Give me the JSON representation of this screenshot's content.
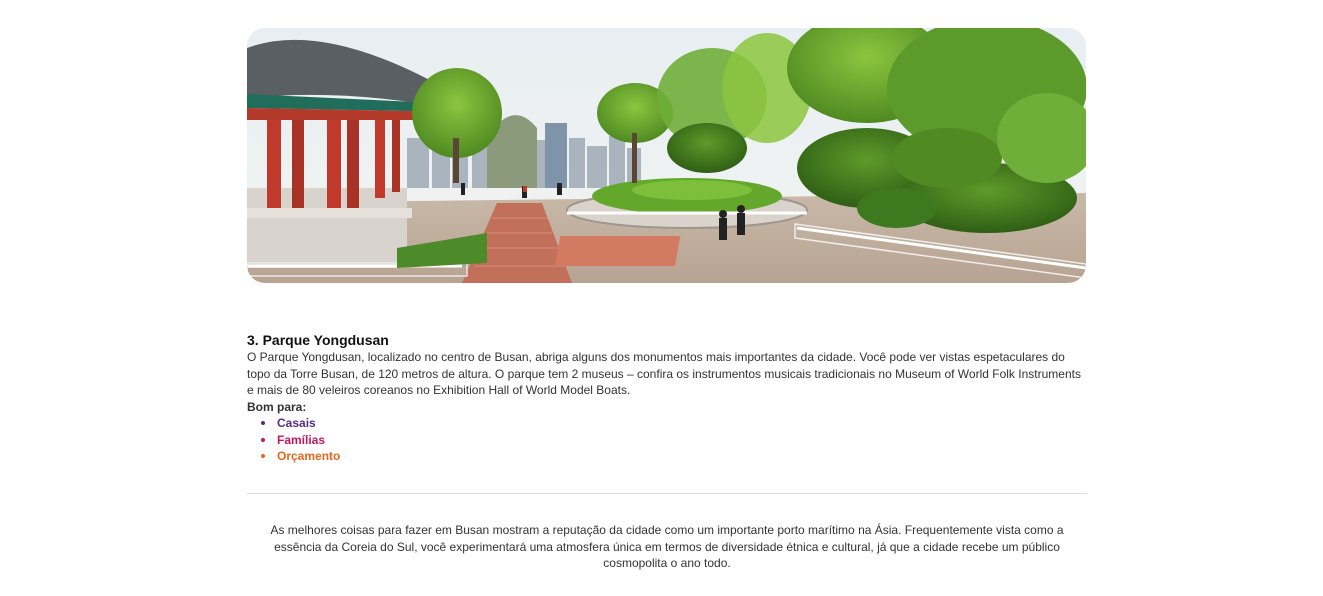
{
  "attraction": {
    "image_alt": "Parque Yongdusan",
    "title": "3. Parque Yongdusan",
    "description": "O Parque Yongdusan, localizado no centro de Busan, abriga alguns dos monumentos mais importantes da cidade. Você pode ver vistas espetaculares do topo da Torre Busan, de 120 metros de altura. O parque tem 2 museus – confira os instrumentos musicais tradicionais no Museum of World Folk Instruments e mais de 80 veleiros coreanos no Exhibition Hall of World Model Boats.",
    "good_for_label": "Bom para:",
    "tags": [
      {
        "label": "Casais",
        "color": "#5b2a86"
      },
      {
        "label": "Famílias",
        "color": "#c2185b"
      },
      {
        "label": "Orçamento",
        "color": "#e8661e"
      }
    ]
  },
  "footer": {
    "text": "As melhores coisas para fazer em Busan mostram a reputação da cidade como um importante porto marítimo na Ásia. Frequentemente vista como a essência da Coreia do Sul, você experimentará uma atmosfera única em termos de diversidade étnica e cultural, já que a cidade recebe um público cosmopolita o ano todo."
  }
}
